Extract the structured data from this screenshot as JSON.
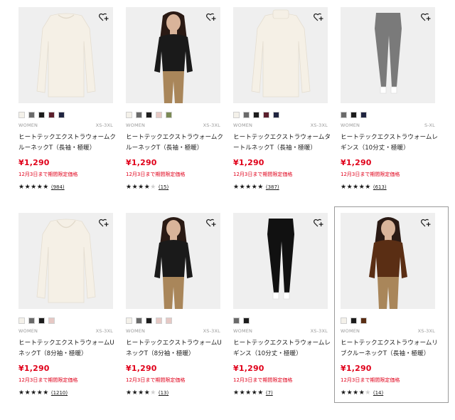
{
  "products": [
    {
      "gender": "WOMEN",
      "sizes": "XS-3XL",
      "name": "ヒートテックエクストラウォームクルーネックT（長袖・極暖）",
      "price": "¥1,290",
      "promo": "12月3日まで期間限定価格",
      "rating_stars": "★★★★★",
      "rating_off": "",
      "reviews": "(984)",
      "swatches": [
        "#f4f1ea",
        "#6a6a6a",
        "#1c1c1c",
        "#5b1f2c",
        "#1f2440"
      ],
      "garment": "long-sleeve-crew",
      "garment_color": "#f5f0e6"
    },
    {
      "gender": "WOMEN",
      "sizes": "XS-3XL",
      "name": "ヒートテックエクストラウォームクルーネックT（長袖・極暖）",
      "price": "¥1,290",
      "promo": "12月3日まで期間限定価格",
      "rating_stars": "★★★★",
      "rating_off": "★",
      "reviews": "(15)",
      "swatches": [
        "#f4f1ea",
        "#6a6a6a",
        "#1c1c1c",
        "#e6c8c4",
        "#7b8a55"
      ],
      "garment": "model-top",
      "garment_color": "#1a1a1a"
    },
    {
      "gender": "WOMEN",
      "sizes": "XS-3XL",
      "name": "ヒートテックエクストラウォームタートルネックT（長袖・極暖）",
      "price": "¥1,290",
      "promo": "12月3日まで期間限定価格",
      "rating_stars": "★★★★★",
      "rating_off": "",
      "reviews": "(387)",
      "swatches": [
        "#f4f1ea",
        "#6a6a6a",
        "#1c1c1c",
        "#5b1f2c",
        "#1f2440"
      ],
      "garment": "turtleneck",
      "garment_color": "#f5f0e6"
    },
    {
      "gender": "WOMEN",
      "sizes": "S-XL",
      "name": "ヒートテックエクストラウォームレギンス（10分丈・極暖）",
      "price": "¥1,290",
      "promo": "12月3日まで期間限定価格",
      "rating_stars": "★★★★★",
      "rating_off": "",
      "reviews": "(613)",
      "swatches": [
        "#6a6a6a",
        "#1c1c1c",
        "#1f2440"
      ],
      "garment": "leggings",
      "garment_color": "#7a7a7a"
    },
    {
      "gender": "WOMEN",
      "sizes": "XS-3XL",
      "name": "ヒートテックエクストラウォームUネックT（8分袖・極暖）",
      "price": "¥1,290",
      "promo": "12月3日まで期間限定価格",
      "rating_stars": "★★★★★",
      "rating_off": "",
      "reviews": "(1210)",
      "swatches": [
        "#f4f1ea",
        "#6a6a6a",
        "#1c1c1c",
        "#e6c8c4"
      ],
      "garment": "long-sleeve-u",
      "garment_color": "#f5f0e6"
    },
    {
      "gender": "WOMEN",
      "sizes": "XS-3XL",
      "name": "ヒートテックエクストラウォームUネックT（8分袖・極暖）",
      "price": "¥1,290",
      "promo": "12月3日まで期間限定価格",
      "rating_stars": "★★★★",
      "rating_off": "★",
      "reviews": "(13)",
      "swatches": [
        "#f4f1ea",
        "#6a6a6a",
        "#1c1c1c",
        "#e6c8c4",
        "#e6c8c4"
      ],
      "garment": "model-top",
      "garment_color": "#1a1a1a"
    },
    {
      "gender": "WOMEN",
      "sizes": "XS-3XL",
      "name": "ヒートテックエクストラウォームレギンス（10分丈・極暖）",
      "price": "¥1,290",
      "promo": "12月3日まで期間限定価格",
      "rating_stars": "★★★★★",
      "rating_off": "",
      "reviews": "(7)",
      "swatches": [
        "#6a6a6a",
        "#1c1c1c"
      ],
      "garment": "leggings",
      "garment_color": "#111111"
    },
    {
      "gender": "WOMEN",
      "sizes": "XS-3XL",
      "name": "ヒートテックエクストラウォームリブクルーネックT（長袖・極暖）",
      "price": "¥1,290",
      "promo": "12月3日まで期間限定価格",
      "rating_stars": "★★★★",
      "rating_off": "★",
      "reviews": "(14)",
      "swatches": [
        "#f4f1ea",
        "#1c1c1c",
        "#5a2e14"
      ],
      "garment": "model-top",
      "garment_color": "#5a2e14"
    }
  ],
  "favorite_icon": "heart-plus-icon",
  "accent_color": "#e0001a"
}
